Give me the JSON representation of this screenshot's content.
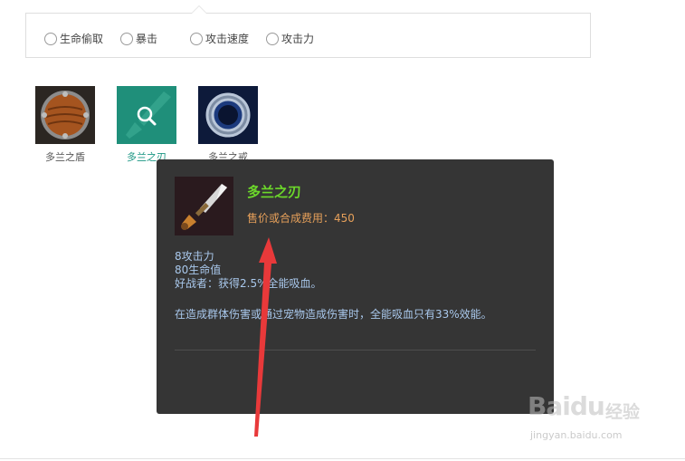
{
  "filters": [
    {
      "label": "生命偷取"
    },
    {
      "label": "暴击"
    },
    {
      "label": "攻击速度"
    },
    {
      "label": "攻击力"
    }
  ],
  "items": [
    {
      "name": "多兰之盾",
      "icon": "shield-icon"
    },
    {
      "name": "多兰之刃",
      "icon": "search-icon"
    },
    {
      "name": "多兰之戒",
      "icon": "ring-icon"
    }
  ],
  "tooltip": {
    "title": "多兰之刃",
    "price_label": "售价或合成费用：450",
    "stats": [
      "8攻击力",
      "80生命值",
      "好战者：获得2.5%全能吸血。"
    ],
    "passive": "在造成群体伤害或通过宠物造成伤害时，全能吸血只有33%效能。",
    "colors": {
      "title": "#6cd82a",
      "price": "#e6a05a",
      "text": "#a9c8ec",
      "background": "#353535"
    }
  },
  "watermark": {
    "logo": "Baidu",
    "cn": "经验",
    "url": "jingyan.baidu.com"
  },
  "accent_color": "#1a9683",
  "annotation_color": "#e8393a"
}
